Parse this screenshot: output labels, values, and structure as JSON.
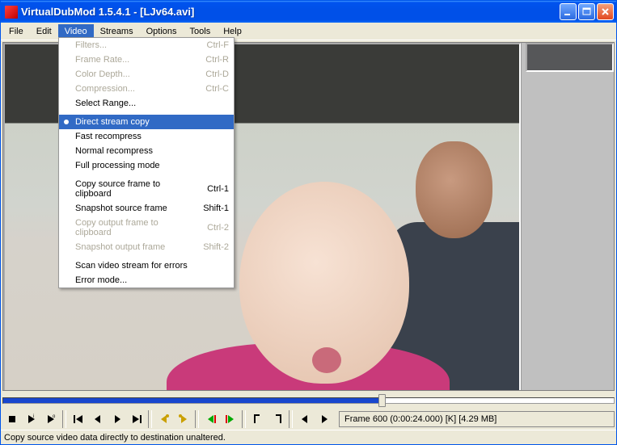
{
  "title": "VirtualDubMod 1.5.4.1 - [LJv64.avi]",
  "menubar": [
    "File",
    "Edit",
    "Video",
    "Streams",
    "Options",
    "Tools",
    "Help"
  ],
  "menu_open_index": 2,
  "dropdown": {
    "groups": [
      [
        {
          "label": "Filters...",
          "shortcut": "Ctrl-F",
          "disabled": true
        },
        {
          "label": "Frame Rate...",
          "shortcut": "Ctrl-R",
          "disabled": true
        },
        {
          "label": "Color Depth...",
          "shortcut": "Ctrl-D",
          "disabled": true
        },
        {
          "label": "Compression...",
          "shortcut": "Ctrl-C",
          "disabled": true
        },
        {
          "label": "Select Range...",
          "shortcut": "",
          "disabled": false
        }
      ],
      [
        {
          "label": "Direct stream copy",
          "shortcut": "",
          "disabled": false,
          "selected": true,
          "bullet": true
        },
        {
          "label": "Fast recompress",
          "shortcut": "",
          "disabled": false
        },
        {
          "label": "Normal recompress",
          "shortcut": "",
          "disabled": false
        },
        {
          "label": "Full processing mode",
          "shortcut": "",
          "disabled": false
        }
      ],
      [
        {
          "label": "Copy source frame to clipboard",
          "shortcut": "Ctrl-1",
          "disabled": false
        },
        {
          "label": "Snapshot source frame",
          "shortcut": "Shift-1",
          "disabled": false
        },
        {
          "label": "Copy output frame to clipboard",
          "shortcut": "Ctrl-2",
          "disabled": true
        },
        {
          "label": "Snapshot output frame",
          "shortcut": "Shift-2",
          "disabled": true
        }
      ],
      [
        {
          "label": "Scan video stream for errors",
          "shortcut": "",
          "disabled": false
        },
        {
          "label": "Error mode...",
          "shortcut": "",
          "disabled": false
        }
      ]
    ]
  },
  "seek": {
    "fill_percent": 62,
    "thumb_percent": 62
  },
  "frame_info": "Frame 600 (0:00:24.000) [K] [4.29 MB]",
  "status": "Copy source video data directly to destination unaltered.",
  "toolbar_icons": [
    "stop-icon",
    "play-input-icon",
    "play-output-icon",
    "sep",
    "go-start-icon",
    "prev-frame-icon",
    "next-frame-icon",
    "go-end-icon",
    "sep",
    "prev-key-icon",
    "next-key-icon",
    "sep",
    "prev-scene-icon",
    "next-scene-icon",
    "sep",
    "mark-in-icon",
    "mark-out-icon",
    "sep",
    "prev-drop-icon",
    "next-drop-icon"
  ]
}
